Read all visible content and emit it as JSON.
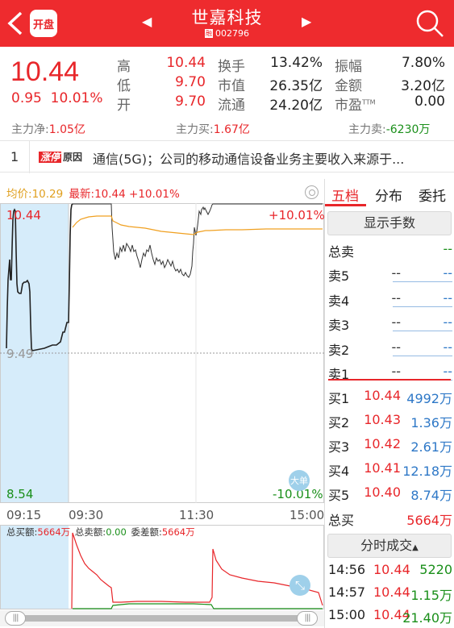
{
  "header": {
    "kaipan": "开盘",
    "title": "世嘉科技",
    "rz_badge": "融",
    "code": "002796"
  },
  "quote": {
    "price": "10.44",
    "change": "0.95",
    "change_pct": "10.01%",
    "rows": [
      [
        {
          "l": "高",
          "v": "10.44",
          "c": "red"
        },
        {
          "l": "换手",
          "v": "13.42%",
          "c": "dark"
        },
        {
          "l": "振幅",
          "v": "7.80%",
          "c": "dark"
        }
      ],
      [
        {
          "l": "低",
          "v": "9.70",
          "c": "red"
        },
        {
          "l": "市值",
          "v": "26.35亿",
          "c": "dark"
        },
        {
          "l": "金额",
          "v": "3.20亿",
          "c": "dark"
        }
      ],
      [
        {
          "l": "开",
          "v": "9.70",
          "c": "red"
        },
        {
          "l": "流通",
          "v": "24.20亿",
          "c": "dark"
        },
        {
          "l": "市盈TTM",
          "v": "0.00",
          "c": "dark"
        }
      ]
    ]
  },
  "flow": {
    "net_label": "主力净:",
    "net": "1.05亿",
    "buy_label": "主力买:",
    "buy": "1.67亿",
    "sell_label": "主力卖:",
    "sell": "-6230万"
  },
  "news": {
    "index": "1",
    "tag1": "涨停",
    "tag2": "原因",
    "text": "通信(5G)；公司的移动通信设备业务主要收入来源于..."
  },
  "chart": {
    "avg_label": "均价:",
    "avg": "10.29",
    "latest_label": "最新:",
    "latest": "10.44",
    "latest_pct": "+10.01%",
    "y_high": "10.44",
    "y_mid": "9.49",
    "y_low": "8.54",
    "pct_high": "+10.01%",
    "pct_low": "-10.01%",
    "times": [
      "09:15",
      "09:30",
      "11:30",
      "15:00"
    ],
    "big_order": "大单"
  },
  "volume": {
    "buy_label": "总买额:",
    "buy": "5664万",
    "sell_label": "总卖额:",
    "sell": "0.00",
    "diff_label": "委差额:",
    "diff": "5664万"
  },
  "panel": {
    "tabs": [
      "五档",
      "分布",
      "委托"
    ],
    "show_hands": "显示手数",
    "total_sell_label": "总卖",
    "total_sell": "--",
    "sell": [
      {
        "k": "卖5",
        "p": "--",
        "v": "--"
      },
      {
        "k": "卖4",
        "p": "--",
        "v": "--"
      },
      {
        "k": "卖3",
        "p": "--",
        "v": "--"
      },
      {
        "k": "卖2",
        "p": "--",
        "v": "--"
      },
      {
        "k": "卖1",
        "p": "--",
        "v": "--"
      }
    ],
    "buy": [
      {
        "k": "买1",
        "p": "10.44",
        "v": "4992万"
      },
      {
        "k": "买2",
        "p": "10.43",
        "v": "1.36万"
      },
      {
        "k": "买3",
        "p": "10.42",
        "v": "2.61万"
      },
      {
        "k": "买4",
        "p": "10.41",
        "v": "12.18万"
      },
      {
        "k": "买5",
        "p": "10.40",
        "v": "8.74万"
      }
    ],
    "total_buy_label": "总买",
    "total_buy": "5664万",
    "trades_btn": "分时成交",
    "trades": [
      {
        "t": "14:56",
        "p": "10.44",
        "v": "5220"
      },
      {
        "t": "14:57",
        "p": "10.44",
        "v": "1.15万"
      },
      {
        "t": "15:00",
        "p": "10.44",
        "v": "21.40万"
      }
    ]
  },
  "colors": {
    "up": "#e8262a",
    "down": "#1a8f1a",
    "header": "#ee2b2e",
    "avg_line": "#f0a020",
    "auction_bg": "#d6ecfa"
  }
}
